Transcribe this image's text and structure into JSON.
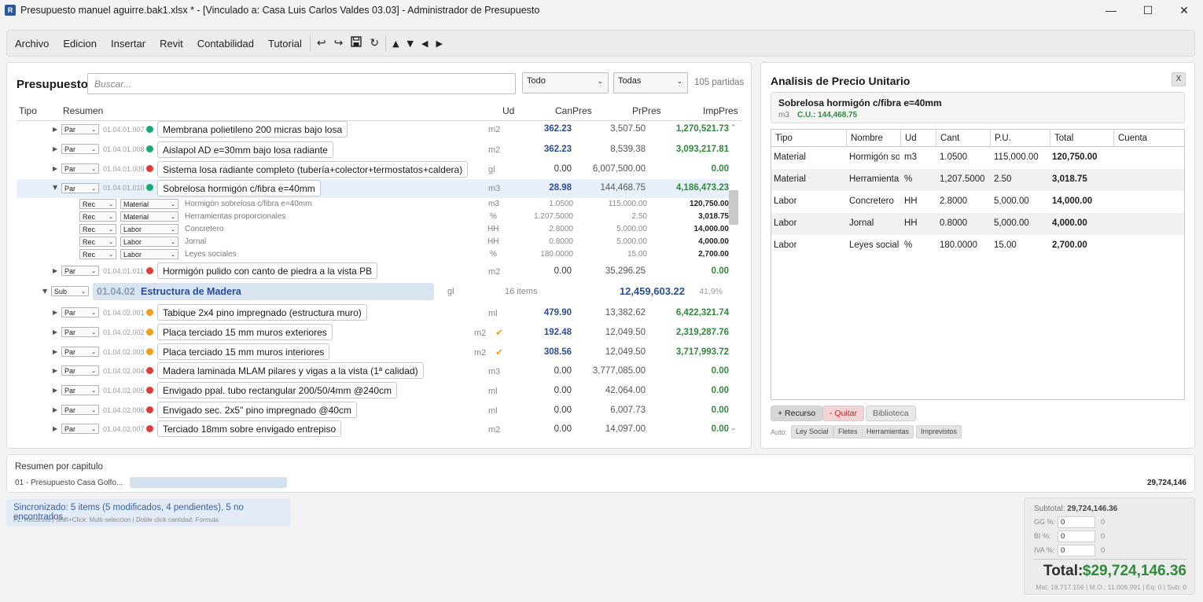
{
  "window": {
    "title": "Presupuesto manuel aguirre.bak1.xlsx * - [Vinculado a: Casa Luis Carlos Valdes 03.03] - Administrador de Presupuesto",
    "app_icon": "R",
    "min": "—",
    "max": "☐",
    "close": "✕"
  },
  "menu": [
    "Archivo",
    "Edicion",
    "Insertar",
    "Revit",
    "Contabilidad",
    "Tutorial"
  ],
  "toolbar_icons": [
    "↩",
    "↪",
    "💾",
    "↻",
    "▲",
    "▼",
    "◀",
    "▶"
  ],
  "presupuesto": {
    "title": "Presupuesto",
    "search_placeholder": "Buscar...",
    "filter1": "Todo",
    "filter2": "Todas",
    "count": "105 partidas",
    "headers": {
      "tipo": "Tipo",
      "resumen": "Resumen",
      "ud": "Ud",
      "can": "CanPres",
      "pr": "PrPres",
      "imp": "ImpPres"
    }
  },
  "rows": [
    {
      "kind": "par",
      "tipo": "Par",
      "code": "01.04.01.007",
      "dot": "#19a974",
      "desc": "Membrana polietileno 200 micras bajo losa",
      "ud": "m2",
      "can": "362.23",
      "pr": "3,507.50",
      "imp": "1,270,521.73",
      "can_zero": false
    },
    {
      "kind": "par",
      "tipo": "Par",
      "code": "01.04.01.008",
      "dot": "#19a974",
      "desc": "Aislapol AD e=30mm bajo losa radiante",
      "ud": "m2",
      "can": "362.23",
      "pr": "8,539.38",
      "imp": "3,093,217.81",
      "can_zero": false
    },
    {
      "kind": "par",
      "tipo": "Par",
      "code": "01.04.01.009",
      "dot": "#e03b3b",
      "desc": "Sistema losa radiante completo (tubería+colector+termostatos+caldera)",
      "ud": "gl",
      "can": "0.00",
      "pr": "6,007,500.00",
      "imp": "0.00",
      "can_zero": true
    },
    {
      "kind": "par",
      "tipo": "Par",
      "code": "01.04.01.010",
      "dot": "#19a974",
      "desc": "Sobrelosa hormigón c/fibra e=40mm",
      "ud": "m3",
      "can": "28.98",
      "pr": "144,468.75",
      "imp": "4,186,473.23",
      "can_zero": false,
      "selected": true,
      "expanded": true
    }
  ],
  "recursos": [
    {
      "tipo": "Rec",
      "clase": "Material",
      "desc": "Hormigón sobrelosa c/fibra e=40mm",
      "ud": "m3",
      "cant": "1.0500",
      "pu": "115,000.00",
      "total": "120,750.00"
    },
    {
      "tipo": "Rec",
      "clase": "Material",
      "desc": "Herramientas proporcionales",
      "ud": "%",
      "cant": "1,207.5000",
      "pu": "2.50",
      "total": "3,018.75"
    },
    {
      "tipo": "Rec",
      "clase": "Labor",
      "desc": "Concretero",
      "ud": "HH",
      "cant": "2.8000",
      "pu": "5,000.00",
      "total": "14,000.00"
    },
    {
      "tipo": "Rec",
      "clase": "Labor",
      "desc": "Jornal",
      "ud": "HH",
      "cant": "0.8000",
      "pu": "5,000.00",
      "total": "4,000.00"
    },
    {
      "tipo": "Rec",
      "clase": "Labor",
      "desc": "Leyes sociales",
      "ud": "%",
      "cant": "180.0000",
      "pu": "15.00",
      "total": "2,700.00"
    }
  ],
  "row_after": {
    "tipo": "Par",
    "code": "01.04.01.011",
    "dot": "#e03b3b",
    "desc": "Hormigón pulido con canto de piedra a la vista PB",
    "ud": "m2",
    "can": "0.00",
    "pr": "35,296.25",
    "imp": "0.00"
  },
  "subcap": {
    "tipo": "Sub",
    "code": "01.04.02",
    "name": "Estructura de Madera",
    "ud": "gl",
    "items": "16 items",
    "total": "12,459,603.22",
    "pct": "41,9%"
  },
  "rows2": [
    {
      "tipo": "Par",
      "code": "01.04.02.001",
      "dot": "#f0a020",
      "desc": "Tabique 2x4 pino impregnado (estructura muro)",
      "ud": "ml",
      "can": "479.90",
      "pr": "13,382.62",
      "imp": "6,422,321.74",
      "can_zero": false,
      "check": false
    },
    {
      "tipo": "Par",
      "code": "01.04.02.002",
      "dot": "#f0a020",
      "desc": "Placa terciado 15 mm muros exteriores",
      "ud": "m2",
      "can": "192.48",
      "pr": "12,049.50",
      "imp": "2,319,287.76",
      "can_zero": false,
      "check": true
    },
    {
      "tipo": "Par",
      "code": "01.04.02.003",
      "dot": "#f0a020",
      "desc": "Placa terciado 15 mm muros interiores",
      "ud": "m2",
      "can": "308.56",
      "pr": "12,049.50",
      "imp": "3,717,993.72",
      "can_zero": false,
      "check": true
    },
    {
      "tipo": "Par",
      "code": "01.04.02.004",
      "dot": "#e03b3b",
      "desc": "Madera laminada MLAM pilares y vigas a la vista (1ª calidad)",
      "ud": "m3",
      "can": "0.00",
      "pr": "3,777,085.00",
      "imp": "0.00",
      "can_zero": true,
      "check": false
    },
    {
      "tipo": "Par",
      "code": "01.04.02.005",
      "dot": "#e03b3b",
      "desc": "Envigado ppal. tubo rectangular 200/50/4mm @240cm",
      "ud": "ml",
      "can": "0.00",
      "pr": "42,064.00",
      "imp": "0.00",
      "can_zero": true,
      "check": false
    },
    {
      "tipo": "Par",
      "code": "01.04.02.006",
      "dot": "#e03b3b",
      "desc": "Envigado sec. 2x5\" pino impregnado @40cm",
      "ud": "ml",
      "can": "0.00",
      "pr": "6,007.73",
      "imp": "0.00",
      "can_zero": true,
      "check": false
    },
    {
      "tipo": "Par",
      "code": "01.04.02.007",
      "dot": "#e03b3b",
      "desc": "Terciado 18mm sobre envigado entrepiso",
      "ud": "m2",
      "can": "0.00",
      "pr": "14,097.00",
      "imp": "0.00",
      "can_zero": true,
      "check": false
    }
  ],
  "apu": {
    "title": "Analisis de Precio Unitario",
    "close": "X",
    "item_title": "Sobrelosa hormigón c/fibra e=40mm",
    "item_ud": "m3",
    "item_cu": "C.U.: 144,468.75",
    "headers": [
      "Tipo",
      "Nombre",
      "Ud",
      "Cant",
      "P.U.",
      "Total",
      "Cuenta"
    ],
    "rows": [
      [
        "Material",
        "Hormigón so",
        "m3",
        "1.0500",
        "115,000.00",
        "120,750.00",
        ""
      ],
      [
        "Material",
        "Herramientas",
        "%",
        "1,207.5000",
        "2.50",
        "3,018.75",
        ""
      ],
      [
        "Labor",
        "Concretero",
        "HH",
        "2.8000",
        "5,000.00",
        "14,000.00",
        ""
      ],
      [
        "Labor",
        "Jornal",
        "HH",
        "0.8000",
        "5,000.00",
        "4,000.00",
        ""
      ],
      [
        "Labor",
        "Leyes sociale:",
        "%",
        "180.0000",
        "15.00",
        "2,700.00",
        ""
      ]
    ],
    "btn_add": "+ Recurso",
    "btn_remove": "- Quitar",
    "btn_lib": "Biblioteca",
    "auto_label": "Auto:",
    "auto_chips": [
      "Ley Social",
      "Fletes",
      "Herramientas",
      "Imprevistos"
    ]
  },
  "resumen": {
    "title": "Resumen por capitulo",
    "chapter": "01 - Presupuesto Casa Golfo...",
    "chapter_total": "29,724,146"
  },
  "status": {
    "main": "Sincronizado: 5 items (5 modificados, 4 pendientes), 5 no encontrados.",
    "hint": "F2: Recursos | Shift+Click: Multi-seleccion | Doble click cantidad: Formula"
  },
  "totals": {
    "subtotal_label": "Subtotal:",
    "subtotal": "29,724,146.36",
    "gg_label": "GG %:",
    "gg_input": "0",
    "gg_val": "0",
    "bi_label": "BI %:",
    "bi_input": "0",
    "bi_val": "0",
    "iva_label": "IVA %:",
    "iva_input": "0",
    "iva_val": "0",
    "total_label": "Total:",
    "total": "$29,724,146.36",
    "breakdown": "Mat: 18.717.156 | M.O.: 11.006.991 | Eq: 0 | Sub: 0"
  }
}
